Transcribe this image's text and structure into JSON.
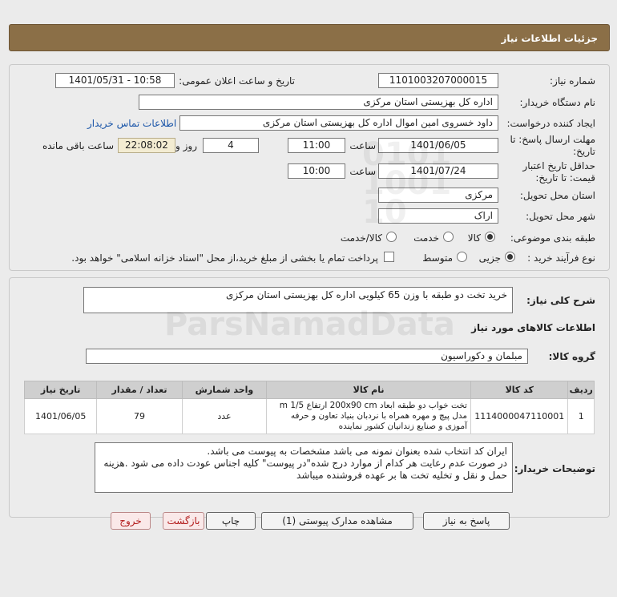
{
  "header": {
    "title": "جزئیات اطلاعات نیاز"
  },
  "form": {
    "need_number_label": "شماره نیاز:",
    "need_number": "1101003207000015",
    "announce_label": "تاریخ و ساعت اعلان عمومی:",
    "announce_value": "1401/05/31 - 10:58",
    "buyer_org_label": "نام دستگاه خریدار:",
    "buyer_org": "اداره کل بهزیستی استان مرکزی",
    "creator_label": "ایجاد کننده درخواست:",
    "creator": "داود خسروی امین اموال اداره کل بهزیستی استان مرکزی",
    "contact_link": "اطلاعات تماس خریدار",
    "deadline_label": "مهلت ارسال پاسخ: تا",
    "deadline_label2": "تاریخ:",
    "deadline_date": "1401/06/05",
    "time_word": "ساعت",
    "deadline_time": "11:00",
    "days": "4",
    "days_label": "روز و",
    "remaining": "22:08:02",
    "remaining_label": "ساعت باقی مانده",
    "validity_label": "حداقل تاریخ اعتبار",
    "validity_label2": "قیمت: تا تاریخ:",
    "validity_date": "1401/07/24",
    "validity_time": "10:00",
    "province_label": "استان محل تحویل:",
    "province": "مرکزی",
    "city_label": "شهر محل تحویل:",
    "city": "اراک",
    "category_label": "طبقه بندی موضوعی:",
    "category_options": [
      "کالا",
      "خدمت",
      "کالا/خدمت"
    ],
    "process_label": "نوع فرآیند خرید :",
    "process_options": [
      "جزیی",
      "متوسط"
    ],
    "payment_note": "پرداخت تمام یا بخشی از مبلغ خرید،از محل \"اسناد خزانه اسلامی\" خواهد بود."
  },
  "description": {
    "label": "شرح کلی نیاز:",
    "text": "خرید تخت دو طبقه با وزن 65 کیلویی اداره کل بهزیستی استان مرکزی"
  },
  "goods": {
    "section_title": "اطلاعات کالاهای مورد نیاز",
    "group_label": "گروه کالا:",
    "group_value": "مبلمان و دکوراسیون"
  },
  "table": {
    "headers": [
      "ردیف",
      "کد کالا",
      "نام کالا",
      "واحد شمارش",
      "تعداد / مقدار",
      "تاریخ نیاز"
    ],
    "rows": [
      {
        "row": "1",
        "code": "1114000047110001",
        "name": "تخت خواب دو طبقه ابعاد 200x90 cm ارتفاع m 1/5 مدل پیچ و مهره همراه با نردبان بنیاد تعاون و حرفه آموزی و صنایع زندانیان کشور نماینده",
        "unit": "عدد",
        "qty": "79",
        "date": "1401/06/05"
      }
    ]
  },
  "buyer_notes": {
    "label": "توضیحات خریدار:",
    "line1": "ایران کد انتخاب شده بعنوان نمونه می باشد مشخصات به پیوست می باشد.",
    "line2": "در صورت عدم رعایت هر کدام از موارد درج شده\"در پیوست\" کلیه اجناس عودت داده می شود .هزینه",
    "line3": "حمل و نقل و تخلیه تخت ها بر عهده فروشنده میباشد"
  },
  "buttons": {
    "reply": "پاسخ به نیاز",
    "attachments": "مشاهده مدارک پیوستی (1)",
    "print": "چاپ",
    "back": "بازگشت",
    "exit": "خروج"
  },
  "watermark": {
    "brand": "ParsNamadData"
  }
}
